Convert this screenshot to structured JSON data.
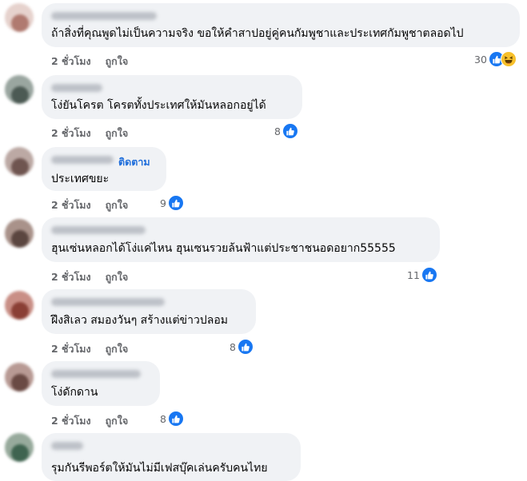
{
  "labels": {
    "time": "2 ชั่วโมง",
    "like": "ถูกใจ",
    "follow": "ติดตาม"
  },
  "colors": {
    "bubble": "#f0f2f5",
    "like_blue": "#1877f2",
    "link_blue": "#216fdb",
    "meta_gray": "#65676b"
  },
  "comments": [
    {
      "text": "ถ้าสิ่งที่คุณพูดไม่เป็นความจริง ขอให้คำสาปอยู่คู่คนกัมพูชาและประเทศกัมพูชาตลอดไป",
      "reaction_count": "30",
      "reaction_icons": [
        "like-icon",
        "haha-icon"
      ]
    },
    {
      "text": "โง่ยันโครต โครตทั้งประเทศให้มันหลอกอยู่ได้",
      "reaction_count": "8",
      "reaction_icons": [
        "like-icon"
      ]
    },
    {
      "text": "ประเทศขยะ",
      "reaction_count": "9",
      "reaction_icons": [
        "like-icon"
      ]
    },
    {
      "text": "ฮุนเซ่นหลอกได้โง่แค่ไหน ฮุนเซนรวยล้นฟ้าแต่ประชาชนอดอยาก55555",
      "reaction_count": "11",
      "reaction_icons": [
        "like-icon"
      ]
    },
    {
      "text": "ฝึงสิเลว สมองวันๆ สร้างแต่ข่าวปลอม",
      "reaction_count": "8",
      "reaction_icons": [
        "like-icon"
      ]
    },
    {
      "text": "โง่ดักดาน",
      "reaction_count": "8",
      "reaction_icons": [
        "like-icon"
      ]
    },
    {
      "text": "รุมกันรีพอร์ตให้มันไม่มีเฟสบุ๊คเล่นครับคนไทย",
      "reaction_count": "",
      "reaction_icons": []
    }
  ]
}
